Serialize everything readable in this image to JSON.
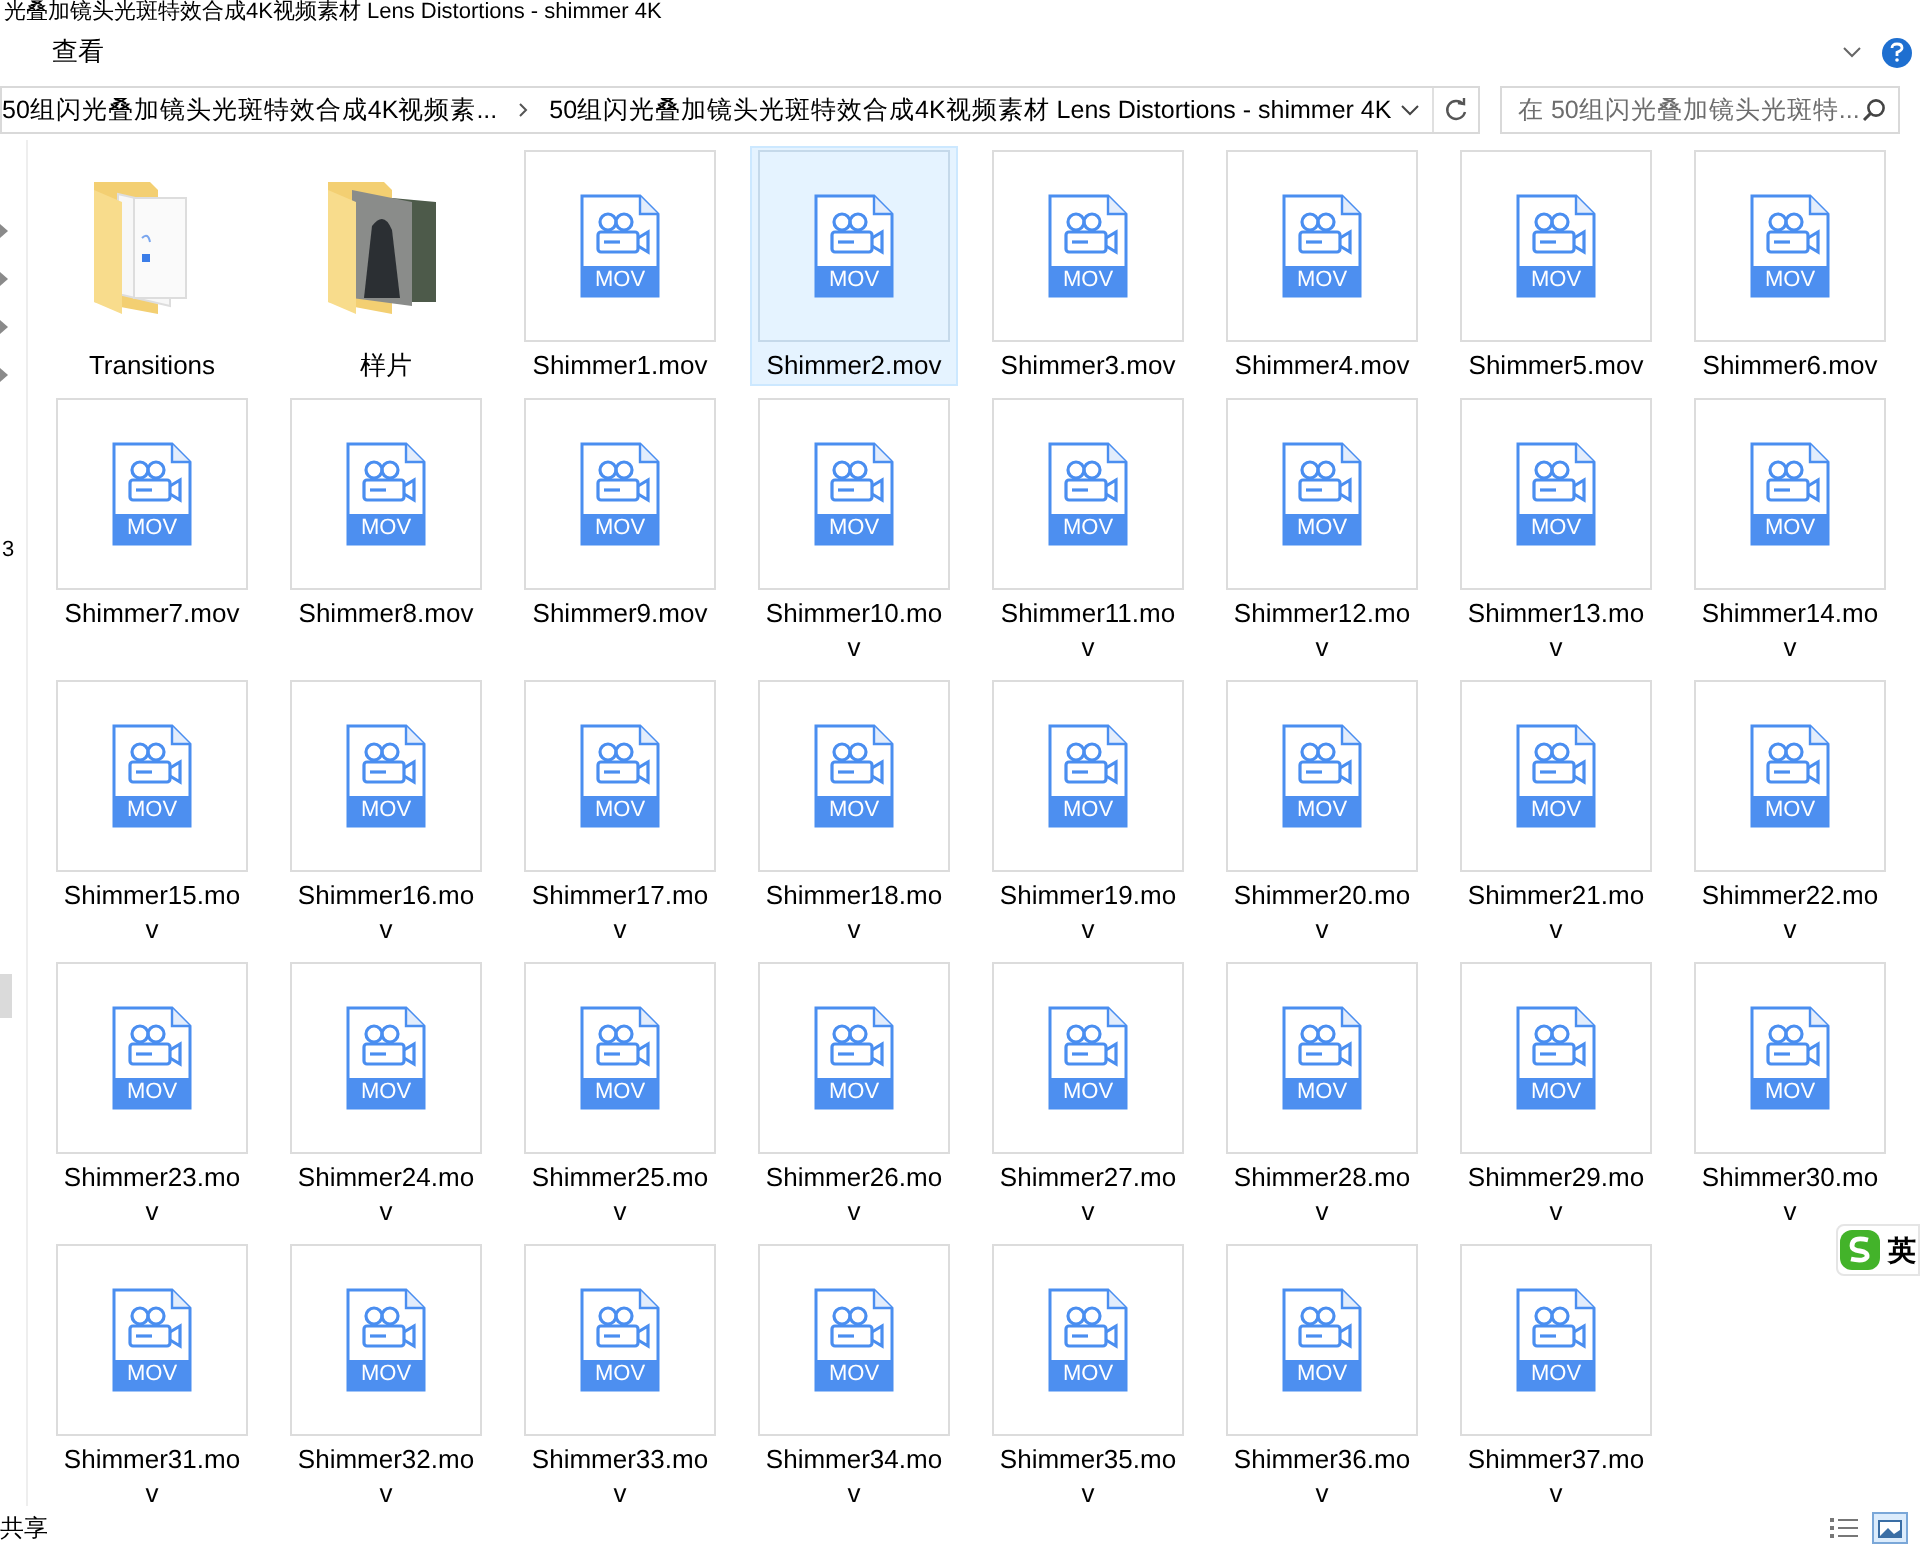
{
  "window": {
    "title": "光叠加镜头光斑特效合成4K视频素材 Lens Distortions - shimmer 4K"
  },
  "ribbon": {
    "tab": "查看"
  },
  "address": {
    "segments": [
      "50组闪光叠加镜头光斑特效合成4K视频素...",
      "50组闪光叠加镜头光斑特效合成4K视频素材 Lens Distortions - shimmer 4K"
    ]
  },
  "search": {
    "placeholder": "在 50组闪光叠加镜头光斑特..."
  },
  "nav_pane": {
    "fragment": "3"
  },
  "items": [
    {
      "kind": "document-folder",
      "name": "Transitions",
      "selected": false
    },
    {
      "kind": "photo-folder",
      "name": "样片",
      "selected": false
    },
    {
      "kind": "file",
      "badge": "MOV",
      "name": "Shimmer1.mov",
      "selected": false
    },
    {
      "kind": "file",
      "badge": "MOV",
      "name": "Shimmer2.mov",
      "selected": true
    },
    {
      "kind": "file",
      "badge": "MOV",
      "name": "Shimmer3.mov",
      "selected": false
    },
    {
      "kind": "file",
      "badge": "MOV",
      "name": "Shimmer4.mov",
      "selected": false
    },
    {
      "kind": "file",
      "badge": "MOV",
      "name": "Shimmer5.mov",
      "selected": false
    },
    {
      "kind": "file",
      "badge": "MOV",
      "name": "Shimmer6.mov",
      "selected": false
    },
    {
      "kind": "file",
      "badge": "MOV",
      "name": "Shimmer7.mov",
      "selected": false
    },
    {
      "kind": "file",
      "badge": "MOV",
      "name": "Shimmer8.mov",
      "selected": false
    },
    {
      "kind": "file",
      "badge": "MOV",
      "name": "Shimmer9.mov",
      "selected": false
    },
    {
      "kind": "file",
      "badge": "MOV",
      "name": "Shimmer10.mov",
      "selected": false
    },
    {
      "kind": "file",
      "badge": "MOV",
      "name": "Shimmer11.mov",
      "selected": false
    },
    {
      "kind": "file",
      "badge": "MOV",
      "name": "Shimmer12.mov",
      "selected": false
    },
    {
      "kind": "file",
      "badge": "MOV",
      "name": "Shimmer13.mov",
      "selected": false
    },
    {
      "kind": "file",
      "badge": "MOV",
      "name": "Shimmer14.mov",
      "selected": false
    },
    {
      "kind": "file",
      "badge": "MOV",
      "name": "Shimmer15.mov",
      "selected": false
    },
    {
      "kind": "file",
      "badge": "MOV",
      "name": "Shimmer16.mov",
      "selected": false
    },
    {
      "kind": "file",
      "badge": "MOV",
      "name": "Shimmer17.mov",
      "selected": false
    },
    {
      "kind": "file",
      "badge": "MOV",
      "name": "Shimmer18.mov",
      "selected": false
    },
    {
      "kind": "file",
      "badge": "MOV",
      "name": "Shimmer19.mov",
      "selected": false
    },
    {
      "kind": "file",
      "badge": "MOV",
      "name": "Shimmer20.mov",
      "selected": false
    },
    {
      "kind": "file",
      "badge": "MOV",
      "name": "Shimmer21.mov",
      "selected": false
    },
    {
      "kind": "file",
      "badge": "MOV",
      "name": "Shimmer22.mov",
      "selected": false
    },
    {
      "kind": "file",
      "badge": "MOV",
      "name": "Shimmer23.mov",
      "selected": false
    },
    {
      "kind": "file",
      "badge": "MOV",
      "name": "Shimmer24.mov",
      "selected": false
    },
    {
      "kind": "file",
      "badge": "MOV",
      "name": "Shimmer25.mov",
      "selected": false
    },
    {
      "kind": "file",
      "badge": "MOV",
      "name": "Shimmer26.mov",
      "selected": false
    },
    {
      "kind": "file",
      "badge": "MOV",
      "name": "Shimmer27.mov",
      "selected": false
    },
    {
      "kind": "file",
      "badge": "MOV",
      "name": "Shimmer28.mov",
      "selected": false
    },
    {
      "kind": "file",
      "badge": "MOV",
      "name": "Shimmer29.mov",
      "selected": false
    },
    {
      "kind": "file",
      "badge": "MOV",
      "name": "Shimmer30.mov",
      "selected": false
    },
    {
      "kind": "file",
      "badge": "MOV",
      "name": "Shimmer31.mov",
      "selected": false
    },
    {
      "kind": "file",
      "badge": "MOV",
      "name": "Shimmer32.mov",
      "selected": false
    },
    {
      "kind": "file",
      "badge": "MOV",
      "name": "Shimmer33.mov",
      "selected": false
    },
    {
      "kind": "file",
      "badge": "MOV",
      "name": "Shimmer34.mov",
      "selected": false
    },
    {
      "kind": "file",
      "badge": "MOV",
      "name": "Shimmer35.mov",
      "selected": false
    },
    {
      "kind": "file",
      "badge": "MOV",
      "name": "Shimmer36.mov",
      "selected": false
    },
    {
      "kind": "file",
      "badge": "MOV",
      "name": "Shimmer37.mov",
      "selected": false
    }
  ],
  "status_bar": {
    "text": "共享"
  },
  "ime_badge": {
    "text": "英"
  }
}
